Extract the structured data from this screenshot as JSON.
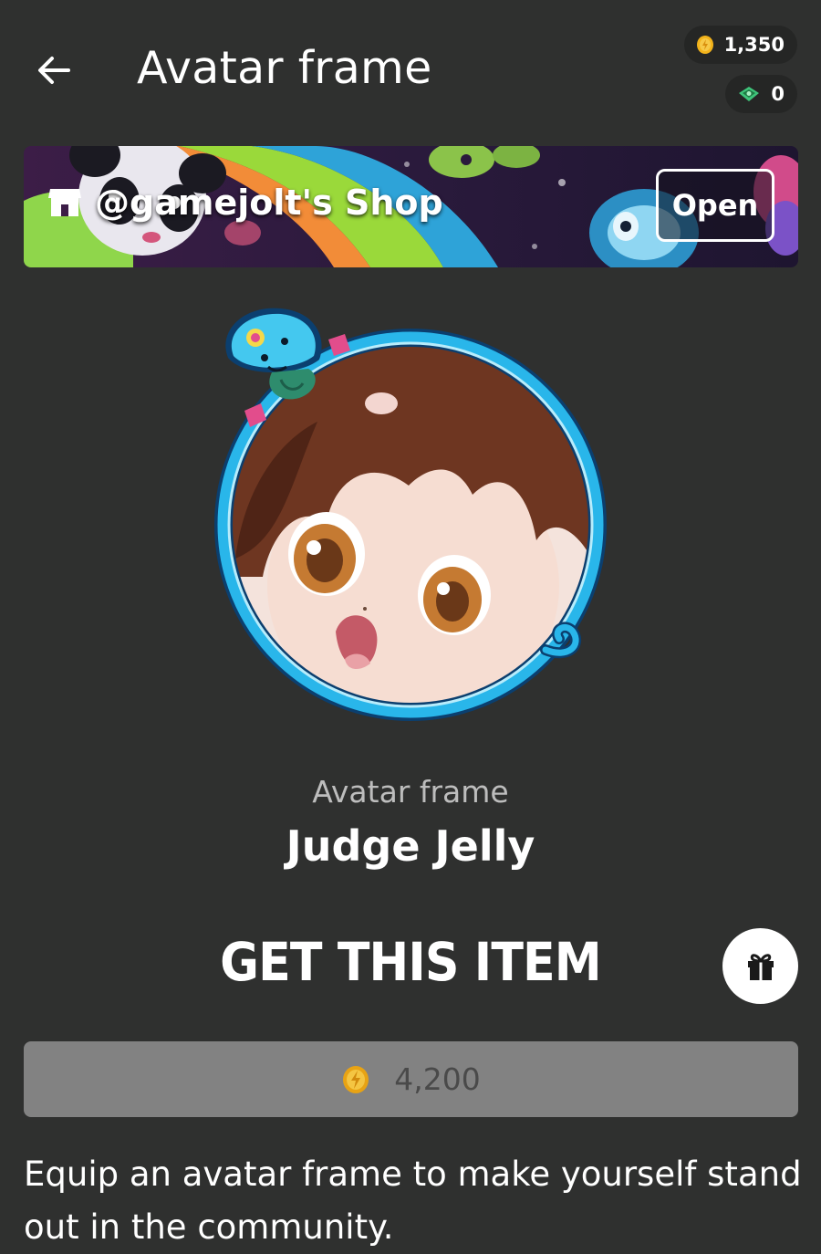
{
  "header": {
    "title": "Avatar frame",
    "back_icon": "arrow-left-icon",
    "coins": "1,350",
    "gems": "0"
  },
  "shop": {
    "name": "@gamejolt's Shop",
    "open_label": "Open",
    "icon": "store-icon"
  },
  "item": {
    "type": "Avatar frame",
    "name": "Judge Jelly",
    "get_title": "GET THIS ITEM",
    "price": "4,200",
    "description": "Equip an avatar frame to make yourself stand out in the community."
  },
  "colors": {
    "background": "#2f302f",
    "frame_blue": "#29b6ea",
    "coin_gold": "#f2b31b",
    "price_button": "#828282"
  }
}
